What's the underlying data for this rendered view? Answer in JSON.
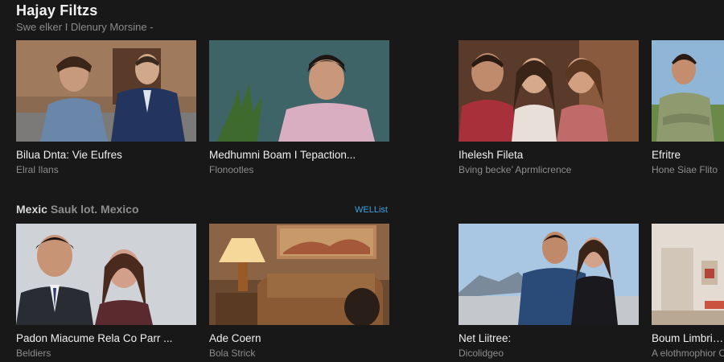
{
  "header": {
    "title": "Hajay Filtzs",
    "subtitle": "Swe elker I Dlenury Morsine -"
  },
  "row1": [
    {
      "title": "Bilua Dnta: Vie Eufres",
      "subtitle": "Elral Ilans",
      "image": "two-people-outdoors-thumbnail"
    },
    {
      "title": "Medhumni Boam I Tepaction...",
      "subtitle": "Flonootles",
      "image": "man-pink-shirt-thumbnail"
    },
    {
      "title": "Ihelesh Fileta",
      "subtitle": "Bving becke’ Aprmlicrence",
      "image": "group-of-three-thumbnail"
    },
    {
      "title": "Efritre",
      "subtitle": "Hone Siae Flito",
      "image": "man-arms-crossed-thumbnail"
    }
  ],
  "section": {
    "title_main": "Mexic",
    "title_muted": "Sauk lot. Mexico",
    "see_all": "WELList"
  },
  "row2": [
    {
      "title": "Padon Miacume Rela Co Parr ...",
      "subtitle": "Beldiers",
      "image": "man-and-woman-portrait-thumbnail"
    },
    {
      "title": "Ade Coern",
      "subtitle": "Bola Strick",
      "image": "living-room-lamp-thumbnail"
    },
    {
      "title": "Net Liitree:",
      "subtitle": "Dicolidgeo",
      "image": "couple-by-sea-thumbnail"
    },
    {
      "title": "Boum Limbries",
      "subtitle": "A elothmophior Co",
      "image": "white-interior-thumbnail"
    }
  ]
}
